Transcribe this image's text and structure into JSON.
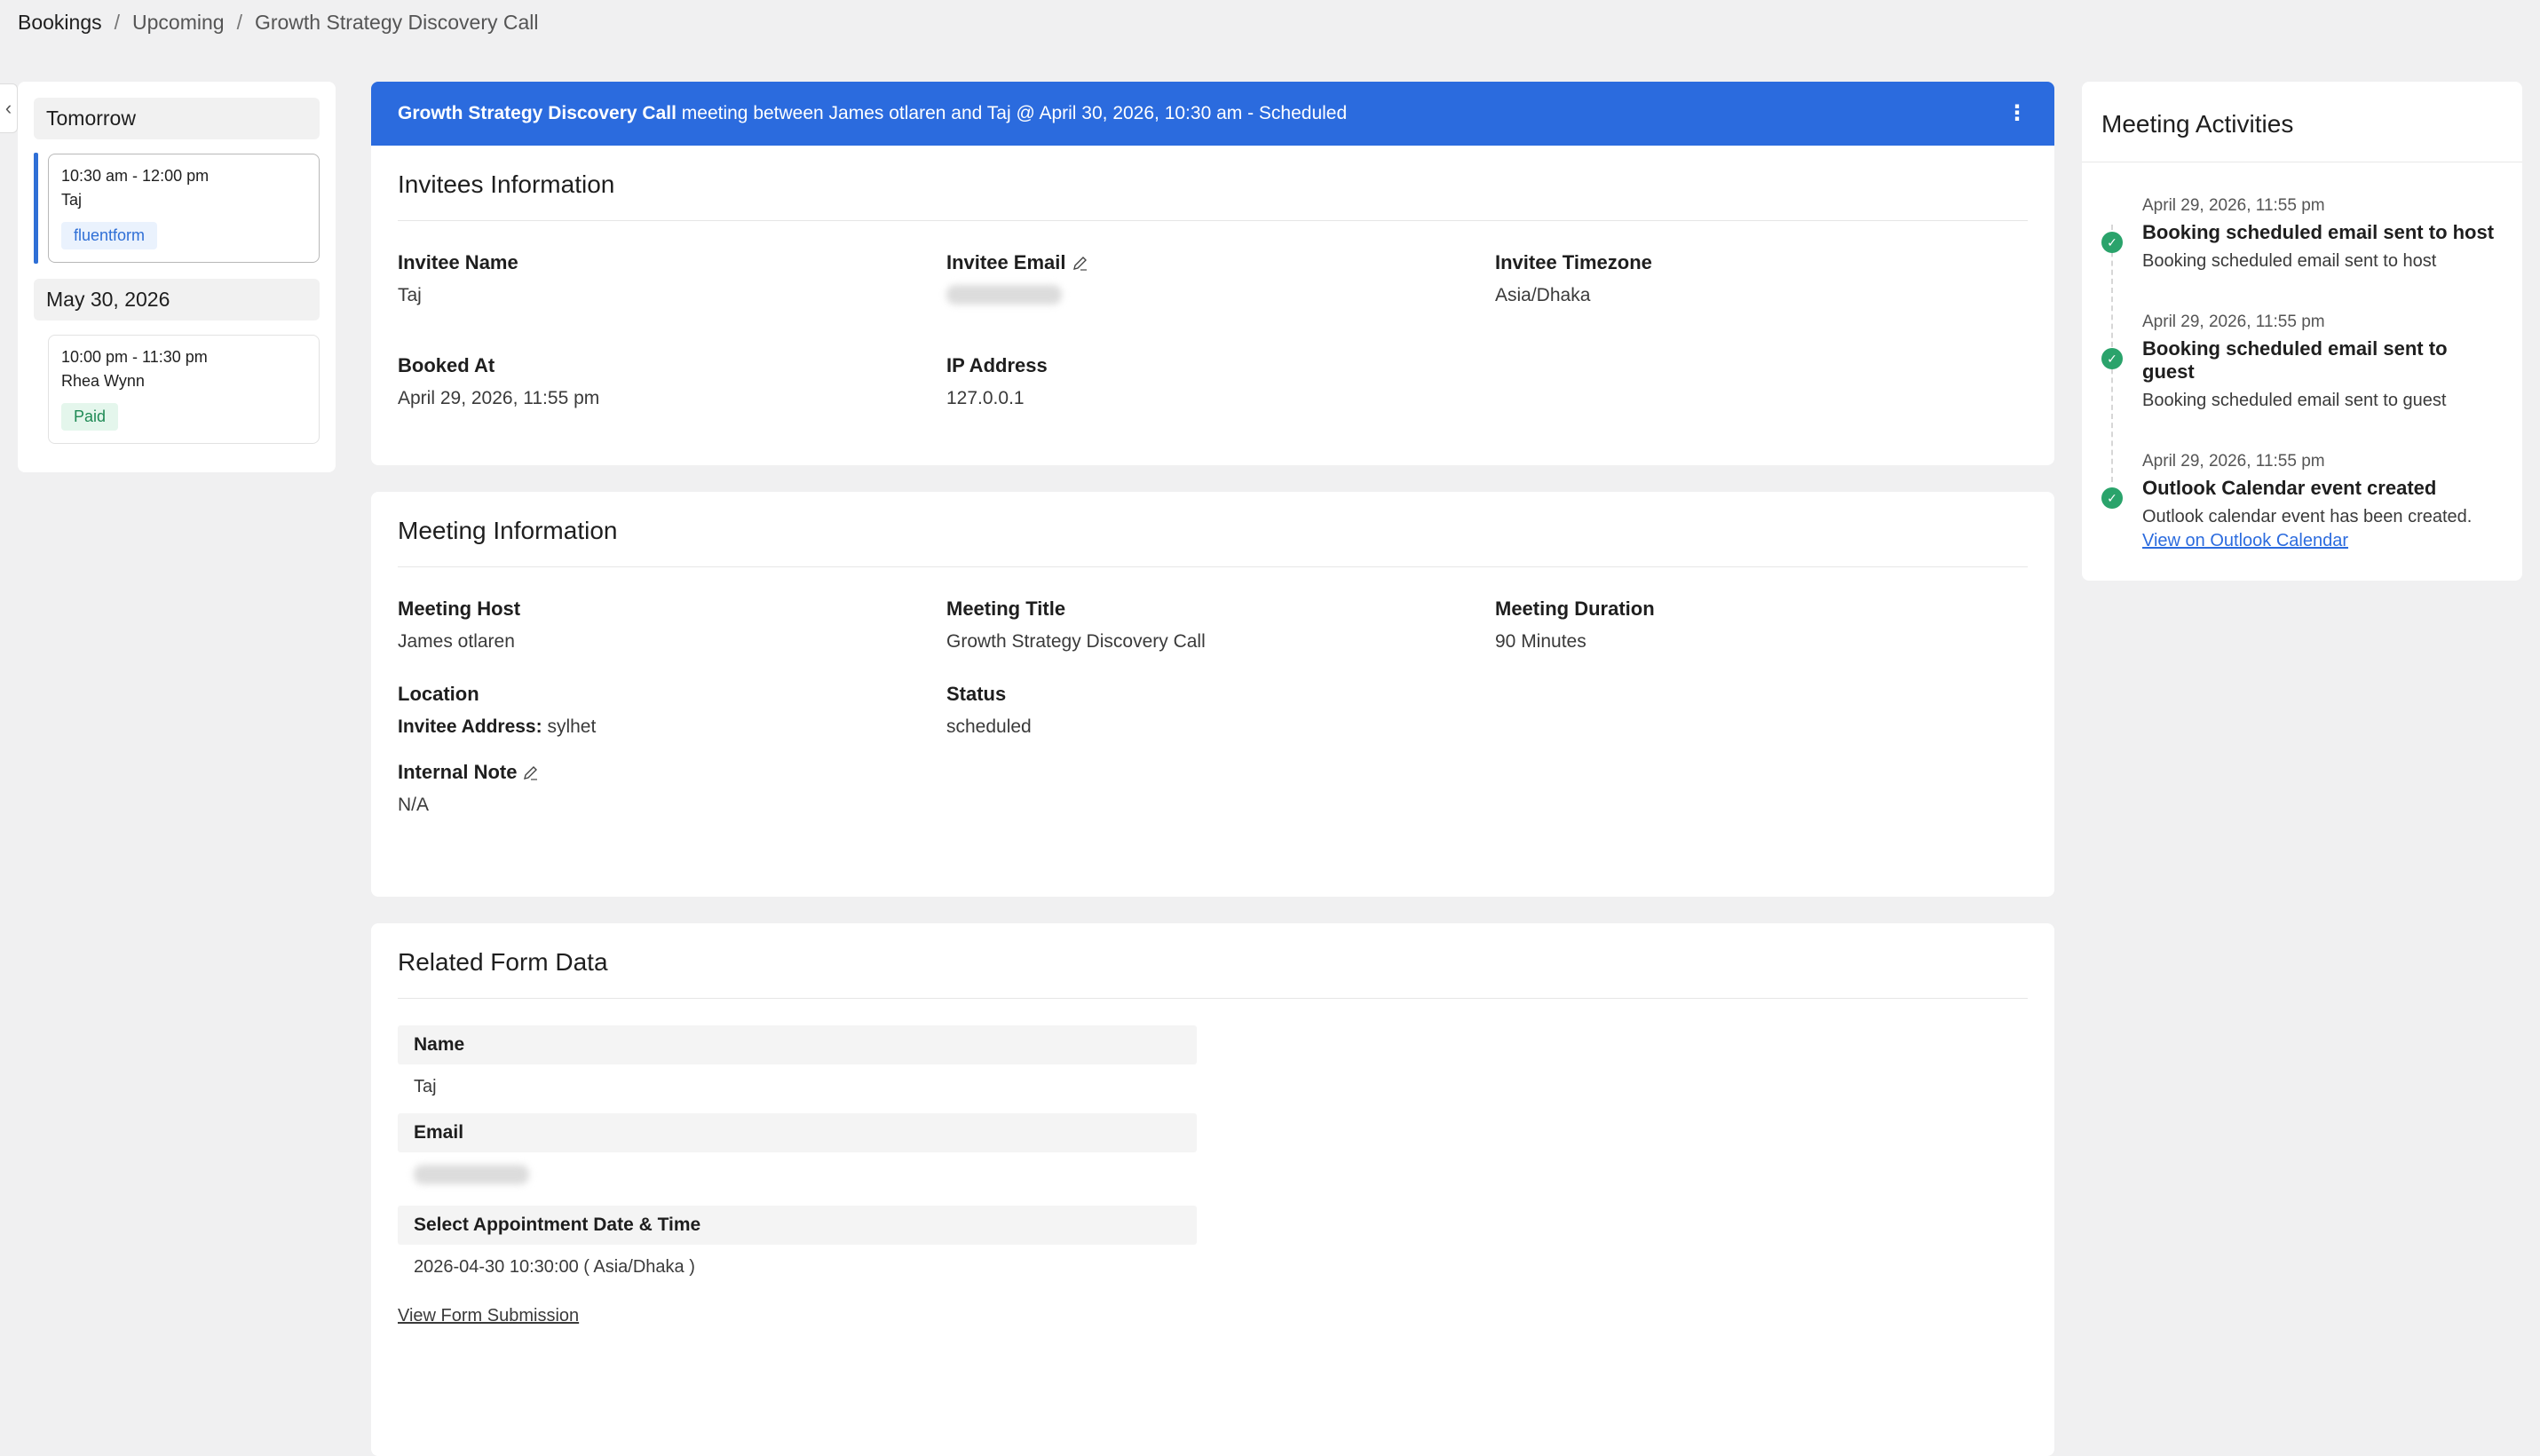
{
  "breadcrumb": {
    "bookings": "Bookings",
    "upcoming": "Upcoming",
    "current": "Growth Strategy Discovery Call",
    "separator": "/"
  },
  "sidebar": {
    "collapse_glyph": "‹",
    "groups": [
      {
        "day": "Tomorrow",
        "slot": {
          "time": "10:30 am - 12:00 pm",
          "who": "Taj",
          "badge": "fluentform"
        }
      },
      {
        "day": "May 30, 2026",
        "slot": {
          "time": "10:00 pm - 11:30 pm",
          "who": "Rhea Wynn",
          "badge": "Paid"
        }
      }
    ]
  },
  "banner": {
    "title": "Growth Strategy Discovery Call",
    "rest": " meeting between James otlaren and Taj @ April 30, 2026, 10:30 am - Scheduled",
    "menu_glyph": "⋮"
  },
  "invitees": {
    "title": "Invitees Information",
    "name_label": "Invitee Name",
    "name": "Taj",
    "email_label": "Invitee Email",
    "timezone_label": "Invitee Timezone",
    "timezone": "Asia/Dhaka",
    "booked_label": "Booked At",
    "booked": "April 29, 2026, 11:55 pm",
    "ip_label": "IP Address",
    "ip": "127.0.0.1"
  },
  "meeting": {
    "title": "Meeting Information",
    "host_label": "Meeting Host",
    "host": "James otlaren",
    "mtitle_label": "Meeting Title",
    "mtitle": "Growth Strategy Discovery Call",
    "duration_label": "Meeting Duration",
    "duration": "90 Minutes",
    "location_label": "Location",
    "location_key": "Invitee Address:",
    "location_val": " sylhet",
    "status_label": "Status",
    "status": "scheduled",
    "note_label": "Internal Note",
    "note": "N/A"
  },
  "form": {
    "title": "Related Form Data",
    "name_label": "Name",
    "name": "Taj",
    "email_label": "Email",
    "date_label": "Select Appointment Date & Time",
    "date": "2026-04-30 10:30:00 ( Asia/Dhaka )",
    "link": "View Form Submission"
  },
  "activities": {
    "title": "Meeting Activities",
    "items": [
      {
        "time": "April 29, 2026, 11:55 pm",
        "head": "Booking scheduled email sent to host",
        "desc": "Booking scheduled email sent to host"
      },
      {
        "time": "April 29, 2026, 11:55 pm",
        "head": "Booking scheduled email sent to guest",
        "desc": "Booking scheduled email sent to guest"
      },
      {
        "time": "April 29, 2026, 11:55 pm",
        "head": "Outlook Calendar event created",
        "desc": "Outlook calendar event has been created.",
        "link": "View on Outlook Calendar"
      }
    ],
    "check_glyph": "✓"
  }
}
